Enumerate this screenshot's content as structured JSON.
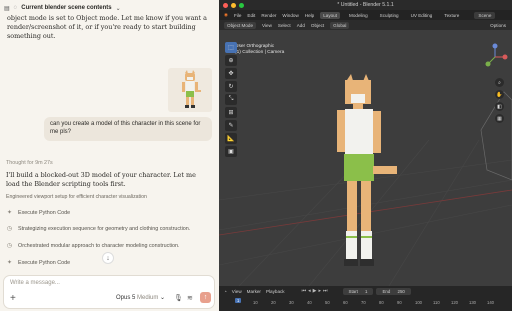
{
  "chat": {
    "header_title": "Current blender scene contents",
    "intro_text": "object mode is set to Object mode. Let me know if you want a render/screenshot of it, or if you're ready to start building something out.",
    "user_message": "can you create a model of this character in this scene for me pls?",
    "thought_label": "Thought for 9m 27s",
    "reply_text": "I'll build a blocked-out 3D model of your character. Let me load the Blender scripting tools first.",
    "engineer_note": "Engineered viewport setup for efficient character visualization",
    "steps": [
      "Execute Python Code",
      "Strategizing execution sequence for geometry and clothing construction.",
      "Orchestrated modular approach to character modeling construction.",
      "Execute Python Code"
    ],
    "composer_placeholder": "Write a message...",
    "model_name": "Opus 5",
    "model_variant": "Medium"
  },
  "blender": {
    "window_title": "* Untitled - Blender 5.1.1",
    "menus": [
      "File",
      "Edit",
      "Render",
      "Window",
      "Help"
    ],
    "workspaces": [
      "Layout",
      "Modeling",
      "Sculpting",
      "UV Editing",
      "Texture"
    ],
    "scene_label": "Scene",
    "header": {
      "mode": "Object Mode",
      "view": "View",
      "select": "Select",
      "add": "Add",
      "object": "Object",
      "transform": "Global",
      "options": "Options"
    },
    "viewport": {
      "view_name": "User Orthographic",
      "collection_line": "(1) Collection | Camera"
    },
    "timeline": {
      "playback": "Playback",
      "view": "View",
      "marker": "Marker",
      "start_label": "Start",
      "start_value": "1",
      "end_label": "End",
      "end_value": "250",
      "current_frame": "1",
      "ticks": [
        "1",
        "10",
        "20",
        "30",
        "40",
        "50",
        "60",
        "70",
        "80",
        "90",
        "100",
        "110",
        "120",
        "130",
        "140",
        "150"
      ]
    }
  },
  "colors": {
    "chat_bg": "#f7f4ee",
    "blender_bg": "#3d3d3d",
    "accent_blue": "#4772b3",
    "send_button": "#e8a08d",
    "character_skin": "#e8b478",
    "character_shorts": "#8bbf4a",
    "character_shirt": "#f2f2ee"
  }
}
